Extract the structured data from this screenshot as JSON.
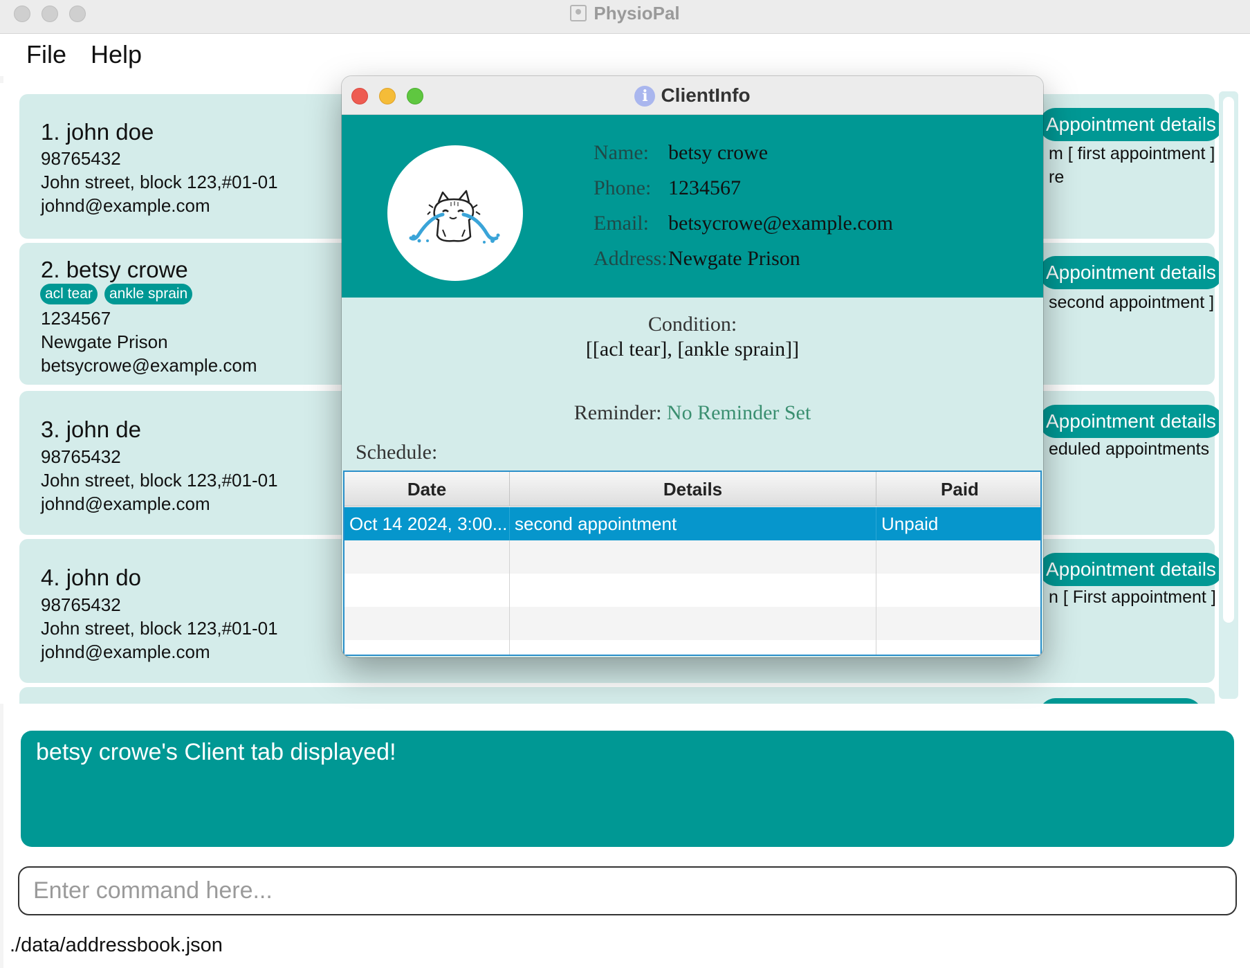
{
  "window": {
    "title": "PhysioPal"
  },
  "menu": {
    "file": "File",
    "help": "Help"
  },
  "persons": [
    {
      "index_name": "1. john doe",
      "phone": "98765432",
      "address": "John street, block 123,#01-01",
      "email": "johnd@example.com",
      "tags": [],
      "appointment_button": "Appointment details",
      "appointment_text": "m [ first appointment ]",
      "appointment_text2": "re"
    },
    {
      "index_name": "2. betsy crowe",
      "phone": "1234567",
      "address": "Newgate Prison",
      "email": "betsycrowe@example.com",
      "tags": [
        "acl tear",
        "ankle sprain"
      ],
      "appointment_button": "Appointment details",
      "appointment_text": "second appointment ]"
    },
    {
      "index_name": "3. john de",
      "phone": "98765432",
      "address": "John street, block 123,#01-01",
      "email": "johnd@example.com",
      "tags": [],
      "appointment_button": "Appointment details",
      "appointment_text": "eduled appointments"
    },
    {
      "index_name": "4. john do",
      "phone": "98765432",
      "address": "John street, block 123,#01-01",
      "email": "johnd@example.com",
      "tags": [],
      "appointment_button": "Appointment details",
      "appointment_text": "n [ First appointment ]"
    }
  ],
  "result": {
    "message": "betsy crowe's Client tab displayed!"
  },
  "command": {
    "placeholder": "Enter command here...",
    "value": ""
  },
  "status": {
    "file_path": "./data/addressbook.json"
  },
  "popup": {
    "title": "ClientInfo",
    "title_icon": "info-icon",
    "avatar_icon": "crying-cat-icon",
    "labels": {
      "name": "Name:",
      "phone": "Phone:",
      "email": "Email:",
      "address": "Address:"
    },
    "client": {
      "name": "betsy crowe",
      "phone": "1234567",
      "email": "betsycrowe@example.com",
      "address": "Newgate Prison"
    },
    "condition_label": "Condition:",
    "condition_value": "[[acl tear], [ankle sprain]]",
    "reminder_label": "Reminder:",
    "reminder_value": "No Reminder Set",
    "schedule_label": "Schedule:",
    "schedule": {
      "columns": [
        "Date",
        "Details",
        "Paid"
      ],
      "rows": [
        {
          "date": "Oct 14 2024, 3:00...",
          "details": "second appointment",
          "paid": "Unpaid",
          "selected": true
        }
      ]
    }
  },
  "colors": {
    "primary": "#009894",
    "card_bg": "#d4ecea",
    "selection": "#0696cc",
    "close": "#ee5c52",
    "minimize": "#f5bc38",
    "maximize": "#5fc740",
    "reminder": "#3a8f70"
  }
}
